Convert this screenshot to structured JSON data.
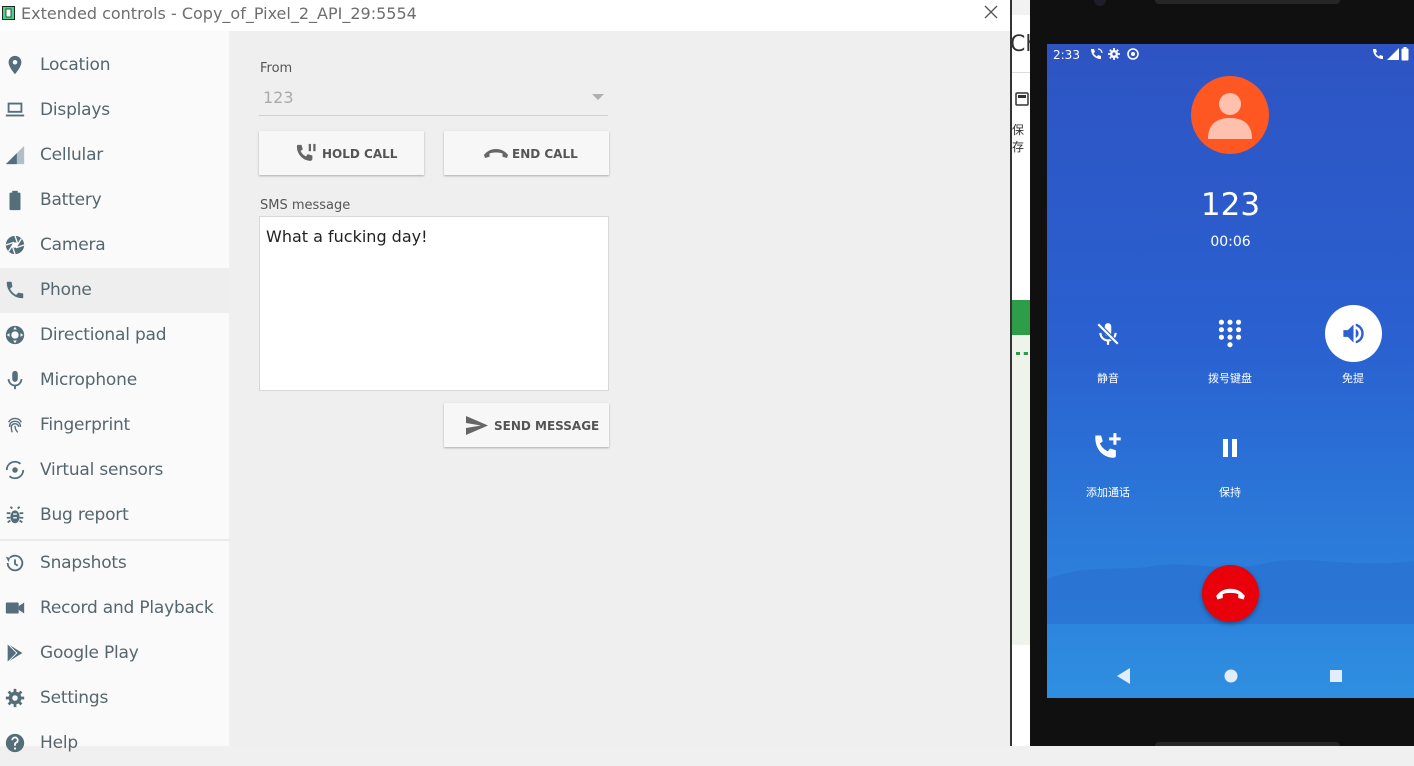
{
  "window": {
    "title": "Extended controls - Copy_of_Pixel_2_API_29:5554"
  },
  "sidebar": {
    "items": [
      {
        "label": "Location",
        "icon": "location-pin-icon"
      },
      {
        "label": "Displays",
        "icon": "display-icon"
      },
      {
        "label": "Cellular",
        "icon": "cellular-icon"
      },
      {
        "label": "Battery",
        "icon": "battery-icon"
      },
      {
        "label": "Camera",
        "icon": "camera-aperture-icon"
      },
      {
        "label": "Phone",
        "icon": "phone-icon",
        "active": true
      },
      {
        "label": "Directional pad",
        "icon": "dpad-icon"
      },
      {
        "label": "Microphone",
        "icon": "microphone-icon"
      },
      {
        "label": "Fingerprint",
        "icon": "fingerprint-icon"
      },
      {
        "label": "Virtual sensors",
        "icon": "rotation-icon"
      },
      {
        "label": "Bug report",
        "icon": "bug-icon"
      },
      {
        "label": "Snapshots",
        "icon": "history-icon"
      },
      {
        "label": "Record and Playback",
        "icon": "videocam-icon"
      },
      {
        "label": "Google Play",
        "icon": "play-store-icon"
      },
      {
        "label": "Settings",
        "icon": "gear-icon"
      },
      {
        "label": "Help",
        "icon": "help-icon"
      }
    ]
  },
  "phone_panel": {
    "from_label": "From",
    "from_value": "123",
    "hold_call_label": "HOLD CALL",
    "end_call_label": "END CALL",
    "sms_label": "SMS message",
    "sms_text": "What a fucking day!",
    "send_message_label": "SEND MESSAGE"
  },
  "background_window": {
    "text_1": "Ch",
    "text_2": "保存"
  },
  "emulator": {
    "status_time": "2:33",
    "caller_number": "123",
    "call_duration": "00:06",
    "controls": {
      "mute": "静音",
      "keypad": "拨号键盘",
      "speaker": "免提",
      "add_call": "添加通话",
      "hold": "保持"
    },
    "colors": {
      "end_call": "#e8000b",
      "avatar": "#ff5722",
      "background": "#2a60d0"
    }
  }
}
